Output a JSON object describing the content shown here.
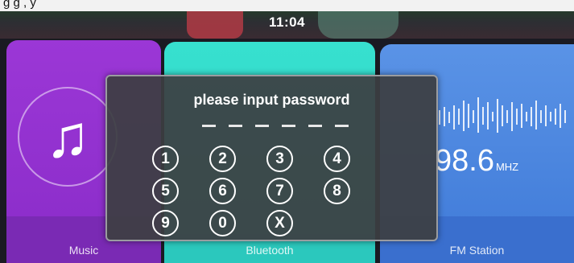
{
  "clock": "11:04",
  "top_strip_text": "g          g    ,  y",
  "dialog": {
    "title": "please input password",
    "password_mask_count": 6
  },
  "keypad": [
    "1",
    "2",
    "3",
    "4",
    "5",
    "6",
    "7",
    "8",
    "9",
    "0",
    "X"
  ],
  "tiles": {
    "music": {
      "label": "Music",
      "icon": "music-note-icon"
    },
    "bluetooth": {
      "label": "Bluetooth"
    },
    "fm": {
      "label": "FM Station",
      "frequency": "98.6",
      "unit": "MHZ"
    }
  },
  "colors": {
    "music": "#9b37d6",
    "bluetooth": "#37e0cf",
    "fm": "#4f8ae2",
    "dialog": "#3c3e42"
  }
}
